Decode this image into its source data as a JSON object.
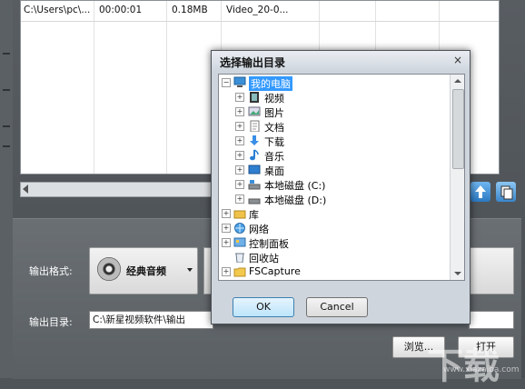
{
  "file_row": {
    "path": "C:\\Users\\pc\\...",
    "duration": "00:00:01",
    "size": "0.18MB",
    "name": "Video_20-0..."
  },
  "panel": {
    "format_label": "输出格式:",
    "format_value": "经典音频",
    "dir_label": "输出目录:",
    "dir_value": "C:\\新星视频软件\\输出",
    "browse_label": "浏览...",
    "open_label": "打开"
  },
  "dialog": {
    "title": "选择输出目录",
    "close": "×",
    "ok_label": "OK",
    "cancel_label": "Cancel",
    "tree": [
      {
        "label": "我的电脑",
        "expander": "−",
        "icon": "computer-icon"
      },
      {
        "label": "视频",
        "expander": "+",
        "icon": "video-folder-icon"
      },
      {
        "label": "图片",
        "expander": "+",
        "icon": "pictures-folder-icon"
      },
      {
        "label": "文档",
        "expander": "+",
        "icon": "documents-folder-icon"
      },
      {
        "label": "下载",
        "expander": "+",
        "icon": "download-folder-icon"
      },
      {
        "label": "音乐",
        "expander": "+",
        "icon": "music-folder-icon"
      },
      {
        "label": "桌面",
        "expander": "+",
        "icon": "desktop-icon"
      },
      {
        "label": "本地磁盘 (C:)",
        "expander": "+",
        "icon": "disk-c-icon"
      },
      {
        "label": "本地磁盘 (D:)",
        "expander": "+",
        "icon": "disk-d-icon"
      },
      {
        "label": "库",
        "expander": "+",
        "icon": "library-icon"
      },
      {
        "label": "网络",
        "expander": "+",
        "icon": "network-icon"
      },
      {
        "label": "控制面板",
        "expander": "+",
        "icon": "control-panel-icon"
      },
      {
        "label": "回收站",
        "expander": "",
        "icon": "recycle-bin-icon"
      },
      {
        "label": "FSCapture",
        "expander": "+",
        "icon": "folder-icon"
      }
    ]
  },
  "watermark": {
    "main": "下载",
    "sub": "www.xiazaiba.com"
  },
  "colors": {
    "selection": "#3399ff",
    "ok_button": "#bde4fa",
    "panel_bg": "#5f6468"
  }
}
